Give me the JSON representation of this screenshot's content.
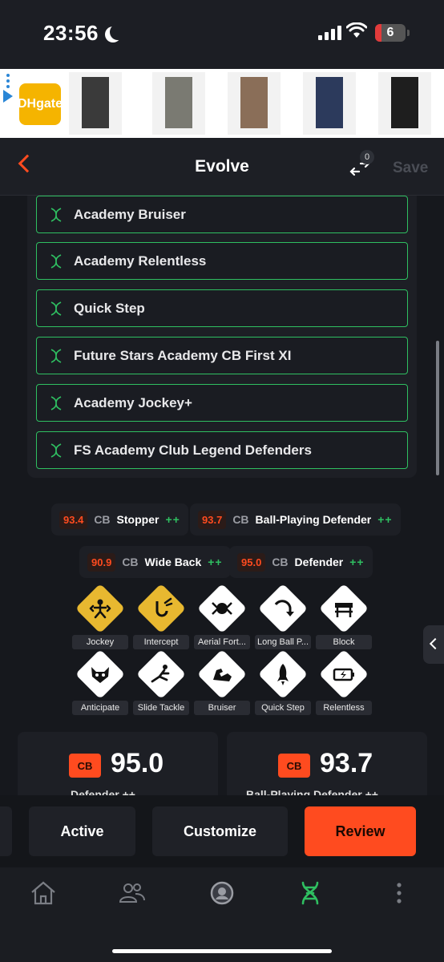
{
  "status_bar": {
    "time": "23:56",
    "battery": "6"
  },
  "ad": {
    "logo_text": "DHgate"
  },
  "header": {
    "title": "Evolve",
    "swap_count": "0",
    "save_label": "Save"
  },
  "evolutions": [
    "Academy Bruiser",
    "Academy Relentless",
    "Quick Step",
    "Future Stars Academy CB First XI",
    "Academy Jockey+",
    "FS Academy Club Legend Defenders"
  ],
  "roles": [
    {
      "score": "93.4",
      "pos": "CB",
      "name": "Stopper",
      "plus": "++"
    },
    {
      "score": "93.7",
      "pos": "CB",
      "name": "Ball-Playing Defender",
      "plus": "++"
    },
    {
      "score": "90.9",
      "pos": "CB",
      "name": "Wide Back",
      "plus": "++"
    },
    {
      "score": "95.0",
      "pos": "CB",
      "name": "Defender",
      "plus": "++"
    }
  ],
  "playstyles": [
    {
      "label": "Jockey",
      "icon": "jockey-icon",
      "tier": "gold"
    },
    {
      "label": "Intercept",
      "icon": "intercept-icon",
      "tier": "gold"
    },
    {
      "label": "Aerial Fort...",
      "icon": "aerial-fortress-icon",
      "tier": "white"
    },
    {
      "label": "Long Ball P...",
      "icon": "long-ball-pass-icon",
      "tier": "white"
    },
    {
      "label": "Block",
      "icon": "block-icon",
      "tier": "white"
    },
    {
      "label": "Anticipate",
      "icon": "anticipate-icon",
      "tier": "white"
    },
    {
      "label": "Slide Tackle",
      "icon": "slide-tackle-icon",
      "tier": "white"
    },
    {
      "label": "Bruiser",
      "icon": "bruiser-icon",
      "tier": "white"
    },
    {
      "label": "Quick Step",
      "icon": "quick-step-icon",
      "tier": "white"
    },
    {
      "label": "Relentless",
      "icon": "relentless-icon",
      "tier": "white"
    }
  ],
  "cards": [
    {
      "pos": "CB",
      "rating": "95.0",
      "role": "Defender ++"
    },
    {
      "pos": "CB",
      "rating": "93.7",
      "role": "Ball-Playing Defender ++"
    }
  ],
  "actions": {
    "active": "Active",
    "customize": "Customize",
    "review": "Review"
  },
  "nav": [
    "home-icon",
    "squad-icon",
    "club-icon",
    "evolutions-icon",
    "more-icon"
  ],
  "colors": {
    "accent": "#ff4b1f",
    "green": "#2fbf61",
    "gold": "#e8b830"
  }
}
